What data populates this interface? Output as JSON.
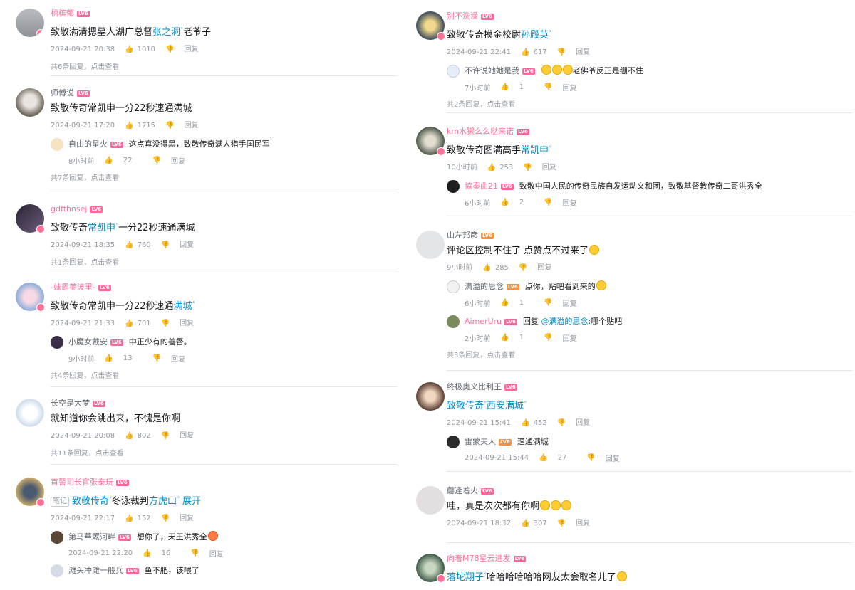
{
  "left": {
    "c1": {
      "user": "柄槟郁",
      "level": "LV6",
      "text_a": "致敬满清摁墓人湖广总督",
      "link": "张之洞",
      "text_b": "老爷子",
      "time": "2024-09-21 20:38",
      "likes": "1010",
      "reply": "回复",
      "more": "共6条回复，点击查看"
    },
    "c2": {
      "user": "师傅说",
      "level": "LV6",
      "text": "致敬传奇常凯申一分22秒速通满城",
      "time": "2024-09-21 17:20",
      "likes": "1715",
      "reply": "回复",
      "sub": {
        "user": "自由的星火",
        "level": "LV6",
        "text": "这点真没得黑，致敬传奇满人猎手国民军",
        "time": "8小时前",
        "likes": "22",
        "reply": "回复"
      },
      "more": "共7条回复，点击查看"
    },
    "c3": {
      "user": "gdfthnsej",
      "level": "LV6",
      "text_a": "致敬传奇",
      "link": "常凯申",
      "text_b": "一分22秒速通满城",
      "time": "2024-09-21 18:35",
      "likes": "760",
      "reply": "回复",
      "more": "共1条回复，点击查看"
    },
    "c4": {
      "user": "-妹霸美波里-",
      "level": "LV6",
      "text_a": "致敬传奇常凯申一分22秒速通",
      "link": "满城",
      "time": "2024-09-21 21:33",
      "likes": "701",
      "reply": "回复",
      "sub": {
        "user": "小魔女戴安",
        "level": "LV6",
        "text": "中正少有的善督。",
        "time": "9小时前",
        "likes": "13",
        "reply": "回复"
      },
      "more": "共4条回复，点击查看"
    },
    "c5": {
      "user": "长空是大梦",
      "level": "LV6",
      "text": "就知道你会跳出来，不愧是你啊",
      "time": "2024-09-21 20:08",
      "likes": "802",
      "reply": "回复",
      "more": "共11条回复，点击查看"
    },
    "c6": {
      "user": "首警司长官张泰玩",
      "level": "LV6",
      "note": "笔记",
      "link_a": "致敬传奇",
      "text_a": "冬泳裁判",
      "link_b": "方虎山",
      "expand": "展开",
      "time": "2024-09-21 22:17",
      "likes": "152",
      "reply": "回复",
      "sub1": {
        "user": "第马華罴河畔",
        "level": "LV6",
        "text": "想你了，天王洪秀全",
        "time": "2024-09-21 22:20",
        "likes": "16",
        "reply": "回复"
      },
      "sub2": {
        "user": "滩头冲滩一般兵",
        "level": "LV6",
        "text": "鱼不肥，该喂了"
      }
    }
  },
  "right": {
    "c1": {
      "user": "别不洗澡",
      "level": "LV6",
      "text_a": "致敬传奇摸金校尉",
      "link": "孙殿英",
      "time": "2024-09-21 22:41",
      "likes": "617",
      "reply": "回复",
      "sub": {
        "user": "不许说她她是我",
        "level": "LV6",
        "text": "老佛爷反正是绷不住",
        "time": "7小时前",
        "likes": "1",
        "reply": "回复"
      },
      "more": "共2条回复，点击查看"
    },
    "c2": {
      "user": "km水獭么么哒来诺",
      "level": "LV6",
      "text_a": "致敬传奇图满高手",
      "link": "常凯申",
      "time": "10小时前",
      "likes": "253",
      "reply": "回复",
      "sub": {
        "user": "協奏曲21",
        "level": "LV6",
        "text": "致敬中国人民的传奇民族自发运动义和团，致敬基督教传奇二哥洪秀全",
        "time": "6小时前",
        "likes": "2",
        "reply": "回复"
      }
    },
    "c3": {
      "user": "山左邦彦",
      "level": "LV6",
      "text": "评论区控制不住了 点赞点不过来了",
      "time": "9小时前",
      "likes": "285",
      "reply": "回复",
      "sub1": {
        "user": "满溢的思念",
        "level": "LV6",
        "text": "点你，贴吧看到来的",
        "time": "6小时前",
        "likes": "1",
        "reply": "回复"
      },
      "sub2": {
        "user": "AimerUru",
        "level": "LV6",
        "text_a": "回复",
        "at": "@满溢的思念",
        "text_b": ":哪个贴吧",
        "time": "2小时前",
        "likes": "1",
        "reply": "回复"
      },
      "more": "共3条回复，点击查看"
    },
    "c4": {
      "user": "终极奥义比利王",
      "level": "LV6",
      "link_a": "致敬传奇",
      "link_b": "西安满城",
      "time": "2024-09-21 15:41",
      "likes": "452",
      "reply": "回复",
      "sub": {
        "user": "雷蒙夫人",
        "level": "LV6",
        "text": "速通满城",
        "time": "2024-09-21 15:44",
        "likes": "27",
        "reply": "回复"
      }
    },
    "c5": {
      "user": "蘑逢着火",
      "level": "LV6",
      "text": "哇，真是次次都有你啊",
      "time": "2024-09-21 18:32",
      "likes": "307",
      "reply": "回复"
    },
    "c6": {
      "user": "向着M78星云进发",
      "level": "LV6",
      "link": "藩坨翔子",
      "text": "哈哈哈哈哈哈网友太会取名儿了"
    }
  }
}
